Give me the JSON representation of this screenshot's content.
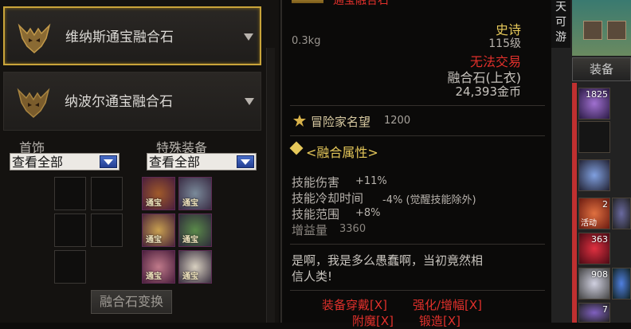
{
  "left_panel": {
    "sets": [
      {
        "name": "维纳斯通宝融合石",
        "selected": true
      },
      {
        "name": "纳波尔通宝融合石",
        "selected": false
      }
    ],
    "filters": [
      {
        "label": "首饰",
        "value": "查看全部"
      },
      {
        "label": "特殊装备",
        "value": "查看全部"
      }
    ],
    "gem_tag": "通宝",
    "convert_button": "融合石变换"
  },
  "tooltip": {
    "header_partial": "通宝融合石",
    "weight": "0.3kg",
    "rarity": "史诗",
    "level": "115级",
    "trade": "无法交易",
    "type": "融合石(上衣)",
    "price": "24,393金币",
    "fame_label": "冒险家名望",
    "fame_value": "1200",
    "fusion_title": "<融合属性>",
    "stats": [
      {
        "name": "技能伤害",
        "value": "+11%"
      },
      {
        "name": "技能冷却时间",
        "value": "-4% (觉醒技能除外)"
      },
      {
        "name": "技能范围",
        "value": "+8%"
      },
      {
        "name": "增益量",
        "value": "3360"
      }
    ],
    "flavor_line1": "是啊，我是多么愚蠢啊，当初竟然相",
    "flavor_line2": "信人类!",
    "footer": [
      "装备穿戴[X]",
      "强化/增幅[X]",
      "附魔[X]",
      "锻造[X]"
    ]
  },
  "right_panel": {
    "top_text": [
      "天",
      "可",
      "游"
    ],
    "equip_button": "装备",
    "item_counts": [
      "1825",
      "2",
      "363",
      "908",
      "7"
    ],
    "item_tag": "活动"
  },
  "colors": {
    "gold": "#e6c85a",
    "red": "#e0302b",
    "text_gray": "#9a958f",
    "selected_border": "#c9a43a"
  }
}
